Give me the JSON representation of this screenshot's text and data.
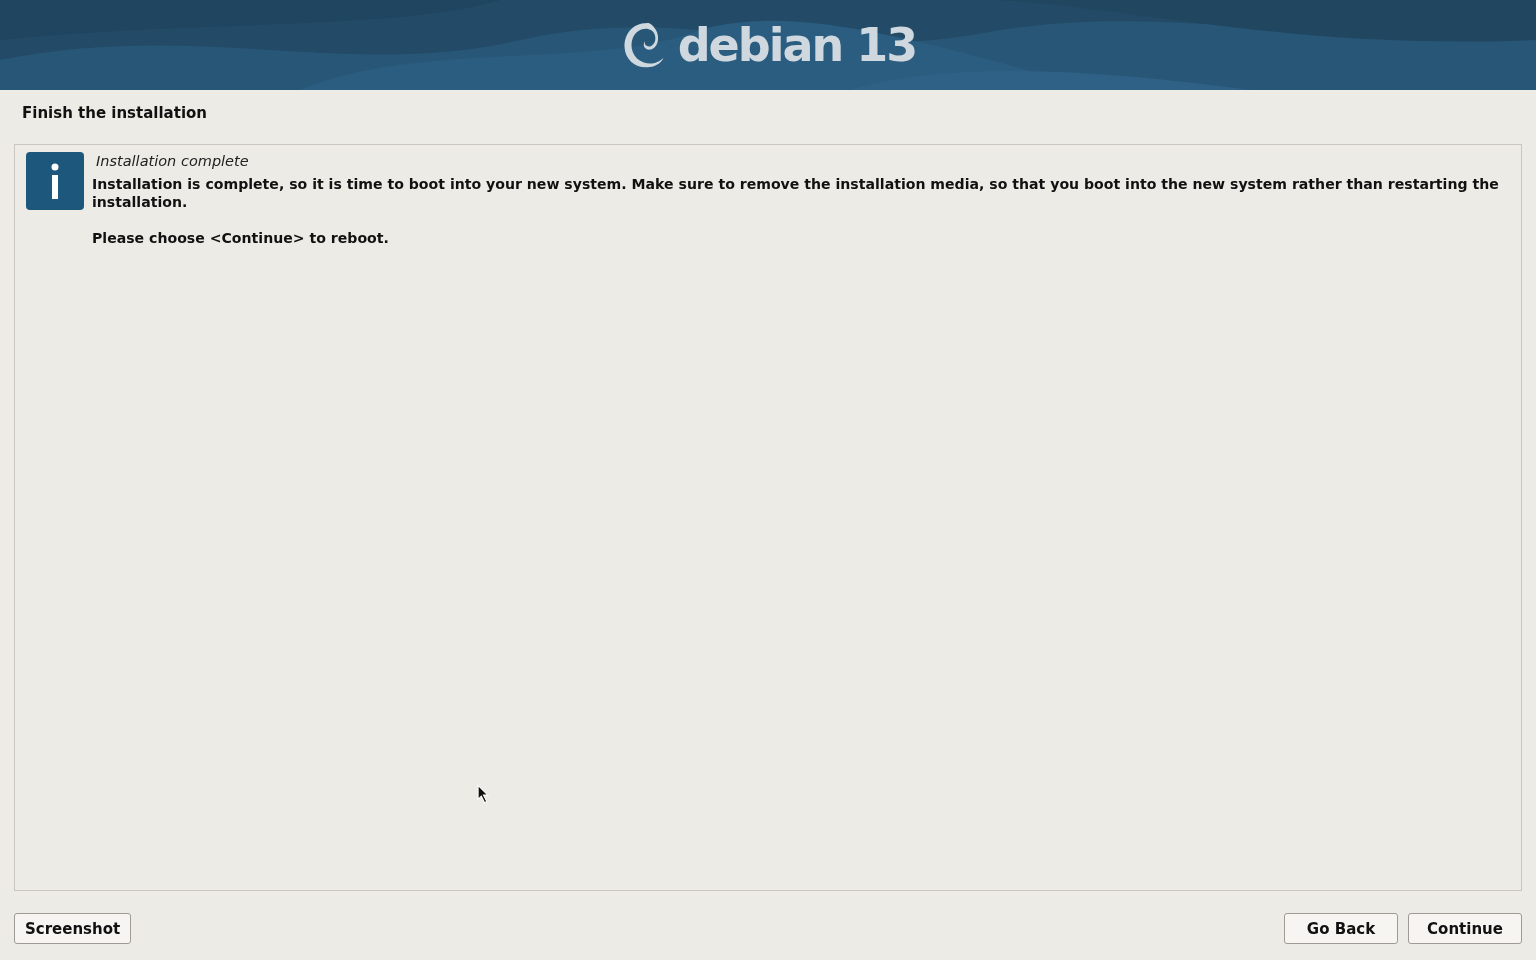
{
  "header": {
    "logo_text": "debian 13"
  },
  "page_title": "Finish the installation",
  "message": {
    "title": "Installation complete",
    "paragraphs": [
      "Installation is complete, so it is time to boot into your new system. Make sure to remove the installation media, so that you boot into the new system rather than restarting the installation.",
      "Please choose <Continue> to reboot."
    ]
  },
  "buttons_left": [
    "Screenshot"
  ],
  "buttons_right": [
    "Go Back",
    "Continue"
  ]
}
